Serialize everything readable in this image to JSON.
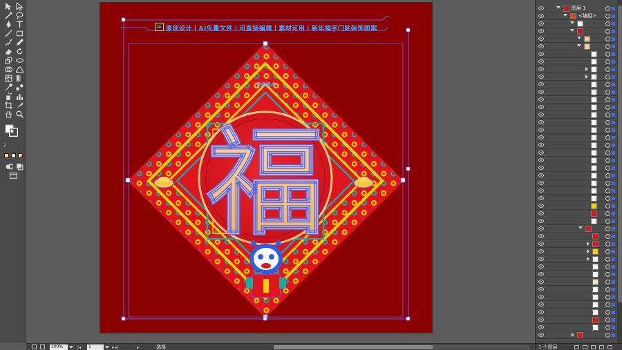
{
  "canvas": {
    "banner_text": "原创设计丨AI矢量文件丨可直接编辑丨素材可用丨新年福字门贴装饰图案",
    "ai_badge": "Ai",
    "year_text": "2024",
    "fu_character": "福"
  },
  "statusbar": {
    "zoom": "100%",
    "page": "1",
    "status": "选择"
  },
  "layers": {
    "top_layer": "图层 1",
    "group_label": "<编组>",
    "footer": "1 个图层"
  },
  "colors": {
    "artboard_bg": "#8b0000",
    "diamond_red": "#e0161e",
    "border_yellow": "#f5d000",
    "teal": "#1fa7a0",
    "fu_gold": "#f6c47a",
    "selection_blue": "#5566ff"
  },
  "icons": [
    "selection-tool-icon",
    "direct-selection-tool-icon",
    "magic-wand-icon",
    "lasso-icon",
    "pen-tool-icon",
    "type-tool-icon",
    "line-tool-icon",
    "rectangle-tool-icon",
    "paintbrush-icon",
    "pencil-icon",
    "eraser-icon",
    "rotate-icon",
    "scale-icon",
    "width-icon",
    "shape-builder-icon",
    "perspective-icon",
    "mesh-icon",
    "gradient-icon",
    "eyedropper-icon",
    "blend-icon",
    "symbol-sprayer-icon",
    "column-graph-icon",
    "artboard-icon",
    "slice-icon",
    "hand-tool-icon",
    "zoom-tool-icon",
    "fill-stroke-icon",
    "screen-mode-icon"
  ]
}
